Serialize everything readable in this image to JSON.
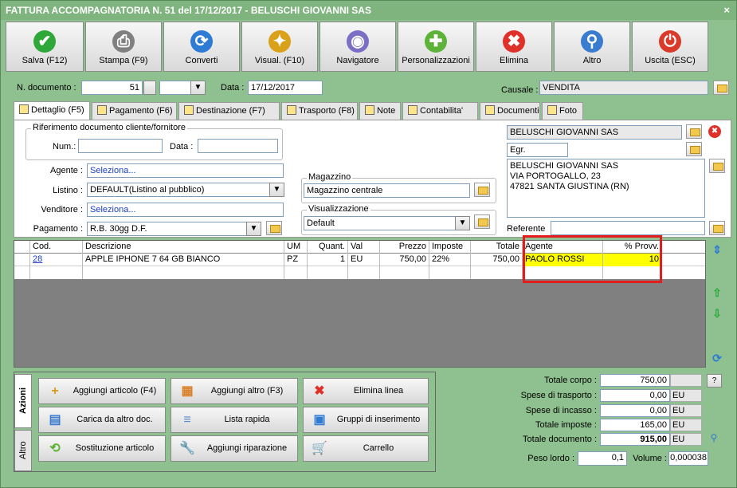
{
  "window": {
    "title": "FATTURA ACCOMPAGNATORIA N. 51 del 17/12/2017 - BELUSCHI GIOVANNI SAS",
    "close_glyph": "×"
  },
  "toolbar": [
    {
      "label": "Salva (F12)",
      "icon": "check-icon",
      "glyph": "✔",
      "color": "#2fa83a"
    },
    {
      "label": "Stampa (F9)",
      "icon": "printer-icon",
      "glyph": "⎙",
      "color": "#808080"
    },
    {
      "label": "Converti",
      "icon": "convert-icon",
      "glyph": "⟳",
      "color": "#2e7bd6"
    },
    {
      "label": "Visual. (F10)",
      "icon": "magic-wand-icon",
      "glyph": "✦",
      "color": "#d9a21a"
    },
    {
      "label": "Navigatore",
      "icon": "compass-icon",
      "glyph": "◉",
      "color": "#7a6fc4"
    },
    {
      "label": "Personalizzazioni",
      "icon": "puzzle-icon",
      "glyph": "✚",
      "color": "#5cb338"
    },
    {
      "label": "Elimina",
      "icon": "delete-x-icon",
      "glyph": "✖",
      "color": "#e0302a"
    },
    {
      "label": "Altro",
      "icon": "search-icon",
      "glyph": "⚲",
      "color": "#3a7ccf"
    },
    {
      "label": "Uscita (ESC)",
      "icon": "power-icon",
      "glyph": "⏻",
      "color": "#d93a2a"
    }
  ],
  "header": {
    "doc_number_label": "N. documento :",
    "doc_number": "51",
    "date_label": "Data :",
    "date": "17/12/2017",
    "causale_label": "Causale :",
    "causale": "VENDITA",
    "dropdown_glyph": "▼"
  },
  "tabs": [
    "Dettaglio (F5)",
    "Pagamento (F6)",
    "Destinazione (F7)",
    "Trasporto (F8)",
    "Note",
    "Contabilita'",
    "Documenti",
    "Foto"
  ],
  "dettaglio": {
    "rif_title": "Riferimento documento cliente/fornitore",
    "num_label": "Num.:",
    "num_value": "",
    "data_label": "Data :",
    "data_value": "",
    "agente_label": "Agente :",
    "agente_value": "Seleziona...",
    "listino_label": "Listino :",
    "listino_value": "DEFAULT(Listino al pubblico)",
    "venditore_label": "Venditore :",
    "venditore_value": "Seleziona...",
    "pagamento_label": "Pagamento :",
    "pagamento_value": "R.B. 30gg D.F.",
    "magazzino_title": "Magazzino",
    "magazzino_value": "Magazzino centrale",
    "visualizzazione_title": "Visualizzazione",
    "visualizzazione_value": "Default",
    "cliente_name": "BELUSCHI GIOVANNI SAS",
    "cliente_titolo": "Egr.",
    "address_lines": [
      "BELUSCHI GIOVANNI SAS",
      "VIA PORTOGALLO, 23",
      "47821 SANTA GIUSTINA (RN)"
    ],
    "referente_label": "Referente",
    "referente_value": ""
  },
  "grid": {
    "columns": [
      "Cod.",
      "Descrizione",
      "UM",
      "Quant.",
      "Val",
      "Prezzo",
      "Imposte",
      "Totale",
      "Agente",
      "% Provv."
    ],
    "rows": [
      [
        "28",
        "APPLE IPHONE 7 64 GB BIANCO",
        "PZ",
        "1",
        "EU",
        "750,00",
        "22%",
        "750,00",
        "PAOLO ROSSI",
        "10"
      ]
    ]
  },
  "actions": {
    "vtabs": [
      "Azioni",
      "Altro"
    ],
    "buttons": [
      {
        "label": "Aggiungi articolo (F4)",
        "icon": "add-article-icon",
        "glyph": "+",
        "color": "#d99a1a"
      },
      {
        "label": "Aggiungi altro (F3)",
        "icon": "add-other-icon",
        "glyph": "▦",
        "color": "#d9822b"
      },
      {
        "label": "Elimina linea",
        "icon": "delete-line-icon",
        "glyph": "✖",
        "color": "#e0302a"
      },
      {
        "label": "Carica da altro doc.",
        "icon": "load-doc-icon",
        "glyph": "▤",
        "color": "#3a7ccf"
      },
      {
        "label": "Lista rapida",
        "icon": "quick-list-icon",
        "glyph": "≡",
        "color": "#5a8ad0"
      },
      {
        "label": "Gruppi di inserimento",
        "icon": "insert-group-icon",
        "glyph": "▣",
        "color": "#2e7bd6"
      },
      {
        "label": "Sostituzione articolo",
        "icon": "replace-article-icon",
        "glyph": "⟲",
        "color": "#5cb338"
      },
      {
        "label": "Aggiungi riparazione",
        "icon": "wrench-icon",
        "glyph": "🔧",
        "color": "#808080"
      },
      {
        "label": "Carrello",
        "icon": "cart-icon",
        "glyph": "🛒",
        "color": "#5a5a5a"
      }
    ]
  },
  "totals": {
    "totale_corpo_label": "Totale corpo :",
    "totale_corpo": "750,00",
    "help_glyph": "?",
    "spese_trasporto_label": "Spese di trasporto :",
    "spese_trasporto": "0,00",
    "spese_incasso_label": "Spese di incasso :",
    "spese_incasso": "0,00",
    "totale_imposte_label": "Totale imposte :",
    "totale_imposte": "165,00",
    "totale_documento_label": "Totale documento :",
    "totale_documento": "915,00",
    "currency": "EU",
    "peso_lordo_label": "Peso lordo :",
    "peso_lordo": "0,1",
    "volume_label": "Volume :",
    "volume": "0,000038"
  },
  "colors": {
    "accent_green": "#8fc08f",
    "highlight_yellow": "#ffff00",
    "highlight_red": "#e31d1d"
  }
}
